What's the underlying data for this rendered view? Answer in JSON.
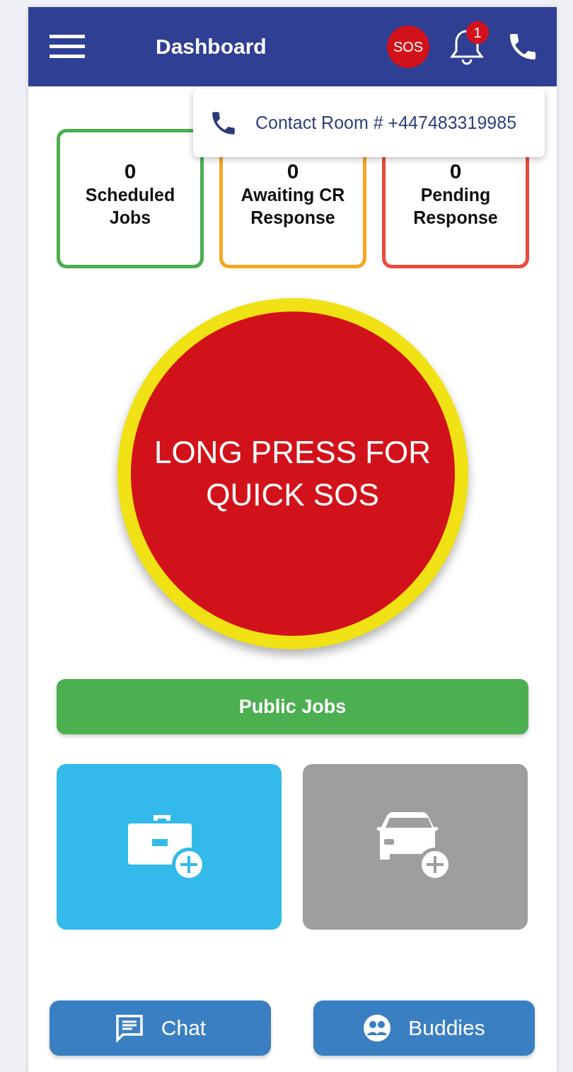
{
  "header": {
    "title": "Dashboard",
    "sos_badge": "SOS",
    "notification_count": "1"
  },
  "contact_popup": {
    "text": "Contact Room # +447483319985"
  },
  "stats": [
    {
      "value": "0",
      "label": "Scheduled Jobs",
      "color": "#4caf50"
    },
    {
      "value": "0",
      "label": "Awaiting CR Response",
      "color": "#f5a623"
    },
    {
      "value": "0",
      "label": "Pending Response",
      "color": "#e84c3d"
    }
  ],
  "sos_button": {
    "text": "LONG PRESS FOR QUICK SOS"
  },
  "public_jobs_button": {
    "label": "Public Jobs"
  },
  "tiles": [
    {
      "kind": "add-job"
    },
    {
      "kind": "add-vehicle"
    }
  ],
  "bottom_buttons": [
    {
      "kind": "chat",
      "label": "Chat"
    },
    {
      "kind": "buddies",
      "label": "Buddies"
    }
  ]
}
